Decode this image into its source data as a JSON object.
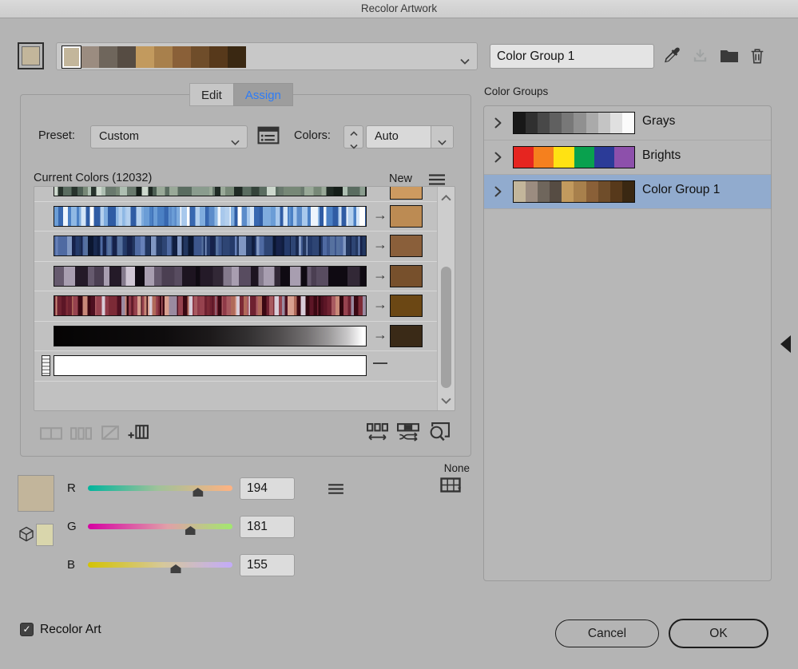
{
  "window": {
    "title": "Recolor Artwork"
  },
  "header": {
    "current_swatch_color": "#c3b69b",
    "strip_swatches": [
      "#c3b69b",
      "#9b8c80",
      "#6f665c",
      "#564c43",
      "#c29a5e",
      "#a8804c",
      "#8a6038",
      "#6f4d2a",
      "#57391b",
      "#3a2812"
    ],
    "group_name": "Color Group 1"
  },
  "tabs": {
    "edit": "Edit",
    "assign": "Assign"
  },
  "preset": {
    "label": "Preset:",
    "value": "Custom"
  },
  "colors_control": {
    "label": "Colors:",
    "value": "Auto"
  },
  "current_colors": {
    "label": "Current Colors (12032)",
    "new_header": "New",
    "arrow_glyph": "→",
    "dash_glyph": "—",
    "rows": [
      {
        "name": "greens",
        "type": "stripes",
        "partial": true,
        "min": 0.8,
        "max": 3.0,
        "palette": [
          "#1f2a24",
          "#34433a",
          "#4d5f54",
          "#69796d",
          "#8a9c8e",
          "#aebfb2",
          "#cdd8cd",
          "#27332c",
          "#5a6c60",
          "#778877",
          "#99a998",
          "#141d18"
        ],
        "new_color": "#cd9a60"
      },
      {
        "name": "light-blues",
        "type": "stripes",
        "min": 0.3,
        "max": 1.8,
        "palette": [
          "#ffffff",
          "#eef5fc",
          "#d4e5f7",
          "#b4d0ee",
          "#8fb8e4",
          "#6b9dd6",
          "#4b80c4",
          "#3868b0",
          "#a8c8ec",
          "#5c8cca",
          "#7facde",
          "#2f5ca4"
        ],
        "new_color": "#bc8b53"
      },
      {
        "name": "dark-blues",
        "type": "stripes",
        "min": 0.3,
        "max": 1.8,
        "palette": [
          "#101e40",
          "#18294f",
          "#22365f",
          "#2e4574",
          "#3d568c",
          "#4f6aa2",
          "#6781b8",
          "#0b1630",
          "#243a6a",
          "#56719f",
          "#8097c2",
          "#16224a"
        ],
        "new_color": "#8a5f3a"
      },
      {
        "name": "purples",
        "type": "stripes",
        "min": 1.2,
        "max": 4.5,
        "palette": [
          "#1d1420",
          "#322836",
          "#4b3f52",
          "#665a6e",
          "#847a8c",
          "#a89eb0",
          "#cfc6d4",
          "#241a28",
          "#584c60",
          "#0f0a12"
        ],
        "new_color": "#77502c"
      },
      {
        "name": "maroons",
        "type": "stripes",
        "min": 0.3,
        "max": 1.6,
        "palette": [
          "#4e1020",
          "#6e2130",
          "#8f3a48",
          "#5c1626",
          "#3a0812",
          "#a85a60",
          "#c88878",
          "#7c2a36",
          "#d8a090",
          "#96424e",
          "#30060e",
          "#b06a5a",
          "#9a8aa0",
          "#d8ccd8"
        ],
        "new_color": "#6b4714"
      },
      {
        "name": "black-ramp",
        "type": "gradient",
        "stops": [
          [
            "#050404",
            0
          ],
          [
            "#0e0c0d",
            35
          ],
          [
            "#1c191a",
            50
          ],
          [
            "#323031",
            62
          ],
          [
            "#4f4c4d",
            72
          ],
          [
            "#737071",
            81
          ],
          [
            "#9b999a",
            88
          ],
          [
            "#c8c7c8",
            94
          ],
          [
            "#ffffff",
            99
          ]
        ],
        "new_color": "#3a2a17"
      },
      {
        "name": "white",
        "type": "solid",
        "color": "#ffffff",
        "grip": true,
        "new_color": null
      },
      {
        "name": "empty",
        "type": "empty"
      }
    ]
  },
  "mixer": {
    "none_label": "None",
    "swatch_color": "#c2b59b",
    "gamut_swatch_color": "#d9d6ac",
    "channels": [
      {
        "label": "R",
        "value": "194"
      },
      {
        "label": "G",
        "value": "181"
      },
      {
        "label": "B",
        "value": "155"
      }
    ]
  },
  "color_groups": {
    "label": "Color Groups",
    "groups": [
      {
        "name": "Grays",
        "selected": false,
        "colors": [
          "#181818",
          "#303030",
          "#484848",
          "#606060",
          "#787878",
          "#909090",
          "#aaaaaa",
          "#c4c4c4",
          "#e0e0e0",
          "#fbfbfb"
        ]
      },
      {
        "name": "Brights",
        "selected": false,
        "colors": [
          "#e62520",
          "#f5801e",
          "#ffe213",
          "#09a14e",
          "#2b3b98",
          "#8d50ab"
        ]
      },
      {
        "name": "Color Group 1",
        "selected": true,
        "colors": [
          "#c3b69b",
          "#9b8c80",
          "#6f665c",
          "#564c43",
          "#c29a5e",
          "#a8804c",
          "#8a6038",
          "#6f4d2a",
          "#57391b",
          "#3a2812"
        ]
      }
    ]
  },
  "footer": {
    "checkbox_label": "Recolor Art",
    "checkbox_checked": true,
    "check_glyph": "✓",
    "cancel_label": "Cancel",
    "ok_label": "OK"
  },
  "colors": {
    "assign_tab_text": "#2e7cf6",
    "selected_group_row_bg": "#91abce",
    "dialog_bg": "#b4b4b4"
  }
}
